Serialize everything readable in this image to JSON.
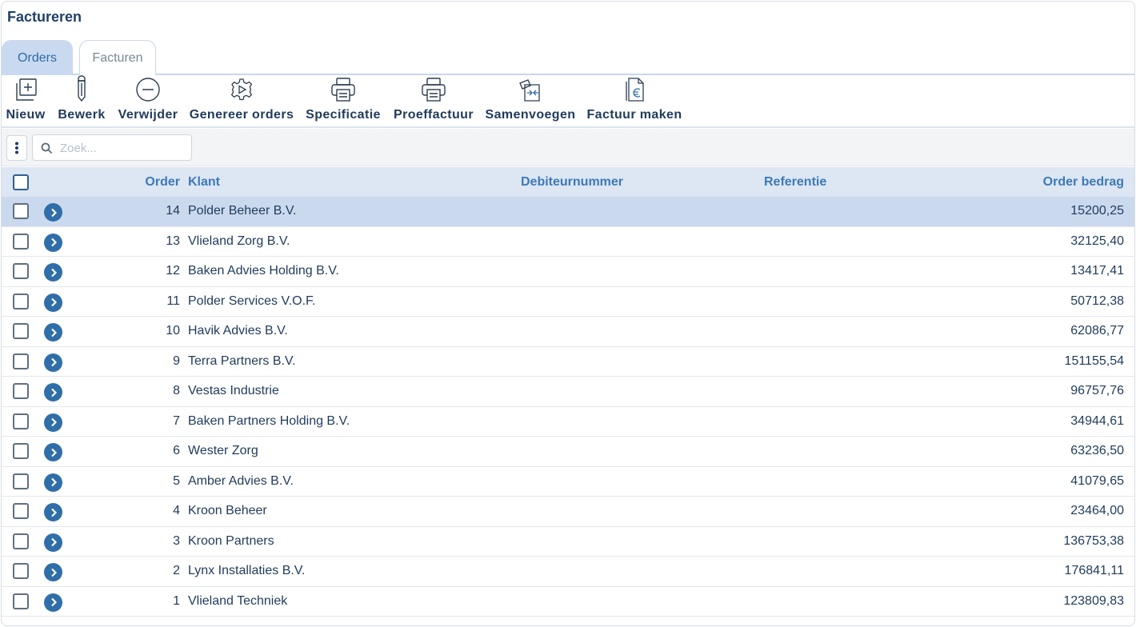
{
  "page": {
    "title": "Factureren"
  },
  "tabs": [
    {
      "label": "Orders",
      "active": true
    },
    {
      "label": "Facturen",
      "active": false
    }
  ],
  "toolbar": {
    "nieuw": {
      "label": "Nieuw",
      "icon": "add-document-icon"
    },
    "bewerk": {
      "label": "Bewerk",
      "icon": "pencil-icon"
    },
    "verwijder": {
      "label": "Verwijder",
      "icon": "minus-circle-icon"
    },
    "genereer": {
      "label": "Genereer orders",
      "icon": "gear-play-icon"
    },
    "specificatie": {
      "label": "Specificatie",
      "icon": "printer-icon"
    },
    "proeffactuur": {
      "label": "Proeffactuur",
      "icon": "printer-icon"
    },
    "samenvoegen": {
      "label": "Samenvoegen",
      "icon": "merge-documents-icon"
    },
    "factuur": {
      "label": "Factuur maken",
      "icon": "euro-document-icon"
    }
  },
  "search": {
    "placeholder": "Zoek..."
  },
  "table": {
    "columns": {
      "order": "Order",
      "klant": "Klant",
      "debiteur": "Debiteurnummer",
      "referentie": "Referentie",
      "bedrag": "Order bedrag"
    },
    "rows": [
      {
        "order": "14",
        "klant": "Polder Beheer B.V.",
        "bedrag": "15200,25",
        "selected": true
      },
      {
        "order": "13",
        "klant": "Vlieland Zorg B.V.",
        "bedrag": "32125,40"
      },
      {
        "order": "12",
        "klant": "Baken Advies Holding B.V.",
        "bedrag": "13417,41"
      },
      {
        "order": "11",
        "klant": "Polder Services V.O.F.",
        "bedrag": "50712,38"
      },
      {
        "order": "10",
        "klant": "Havik Advies B.V.",
        "bedrag": "62086,77"
      },
      {
        "order": "9",
        "klant": "Terra Partners B.V.",
        "bedrag": "151155,54"
      },
      {
        "order": "8",
        "klant": "Vestas Industrie",
        "bedrag": "96757,76"
      },
      {
        "order": "7",
        "klant": "Baken Partners Holding B.V.",
        "bedrag": "34944,61"
      },
      {
        "order": "6",
        "klant": "Wester Zorg",
        "bedrag": "63236,50"
      },
      {
        "order": "5",
        "klant": "Amber Advies B.V.",
        "bedrag": "41079,65"
      },
      {
        "order": "4",
        "klant": "Kroon Beheer",
        "bedrag": "23464,00"
      },
      {
        "order": "3",
        "klant": "Kroon Partners",
        "bedrag": "136753,38"
      },
      {
        "order": "2",
        "klant": "Lynx Installaties B.V.",
        "bedrag": "176841,11"
      },
      {
        "order": "1",
        "klant": "Vlieland Techniek",
        "bedrag": "123809,83"
      }
    ]
  },
  "colors": {
    "accent": "#2f6ea8",
    "header_bg": "#dde6f3",
    "selected_row": "#cbd9ee",
    "text": "#1f3b5c"
  }
}
